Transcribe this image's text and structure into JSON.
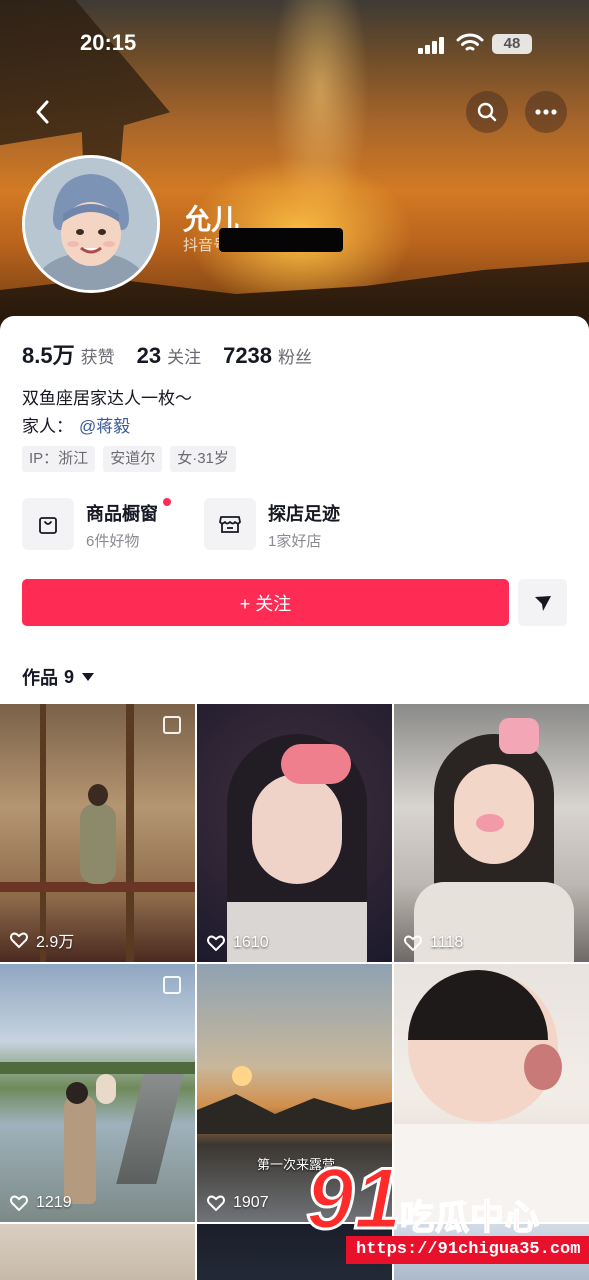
{
  "status_bar": {
    "time": "20:15",
    "battery": "48"
  },
  "profile": {
    "nickname": "允儿",
    "id_prefix": "抖音号",
    "stats": [
      {
        "value": "8.5万",
        "label": "获赞"
      },
      {
        "value": "23",
        "label": "关注"
      },
      {
        "value": "7238",
        "label": "粉丝"
      }
    ],
    "bio": "双鱼座居家达人一枚～",
    "family_label": "家人：",
    "family_mention": "@蒋毅",
    "tags": [
      "IP：浙江",
      "安道尔",
      "女·31岁"
    ]
  },
  "features": [
    {
      "title": "商品橱窗",
      "subtitle": "6件好物",
      "icon": "shopping-bag-icon",
      "has_dot": true
    },
    {
      "title": "探店足迹",
      "subtitle": "1家好店",
      "icon": "store-icon",
      "has_dot": false
    }
  ],
  "actions": {
    "follow_label": "+ 关注"
  },
  "works": {
    "label": "作品",
    "count": "9"
  },
  "grid": [
    {
      "likes": "2.9万",
      "multi": true
    },
    {
      "likes": "1610",
      "multi": false
    },
    {
      "likes": "1118",
      "multi": false
    },
    {
      "likes": "1219",
      "multi": true
    },
    {
      "likes": "1907",
      "multi": false
    },
    {
      "likes": "",
      "multi": false
    }
  ],
  "tile5_caption": "第一次来露营",
  "watermark": {
    "big": "91",
    "cn": "吃瓜中心",
    "url": "https://91chigua35.com"
  },
  "colors": {
    "accent": "#fe2c55",
    "mention": "#3a5a9b",
    "watermark_red": "#ff2a2a"
  }
}
